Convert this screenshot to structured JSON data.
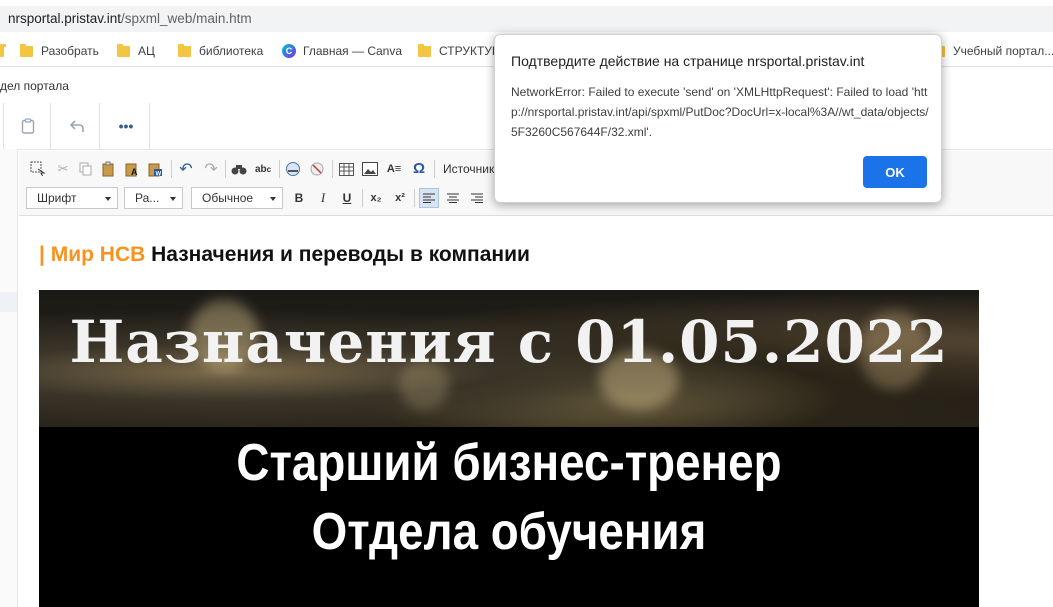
{
  "address_bar": {
    "host": "nrsportal.pristav.int",
    "path": "/spxml_web/main.htm"
  },
  "bookmarks": [
    {
      "label": "Разобрать",
      "icon": "folder-icon"
    },
    {
      "label": "АЦ",
      "icon": "folder-icon"
    },
    {
      "label": "библиотека",
      "icon": "folder-icon"
    },
    {
      "label": "Главная — Canva",
      "icon": "canva-icon"
    },
    {
      "label": "СТРУКТУРА",
      "icon": "folder-icon"
    },
    {
      "label": "Учебный портал...",
      "icon": "folder-icon"
    }
  ],
  "portal_strip": {
    "text": "дел портала"
  },
  "app_toolbar": {
    "icons": [
      "clipboard-icon",
      "undo-icon",
      "more-icon"
    ]
  },
  "editor_toolbar": {
    "source_label": "Источник",
    "font_combo": "Шрифт",
    "size_combo": "Ра...",
    "format_combo": "Обычное",
    "bold": "B",
    "italic": "I",
    "underline": "U",
    "subscript": "x₂",
    "superscript": "x²",
    "omega": "Ω"
  },
  "content": {
    "heading_accent": "| Мир НСВ",
    "heading_text": "Назначения и переводы в компании",
    "banner": {
      "title": "Назначения с 01.05.2022",
      "line1": "Старший бизнес-тренер",
      "line2": "Отдела обучения"
    }
  },
  "dialog": {
    "title": "Подтвердите действие на странице nrsportal.pristav.int",
    "message": "NetworkError: Failed to execute 'send' on 'XMLHttpRequest': Failed to load 'http://nrsportal.pristav.int/api/spxml/PutDoc?DocUrl=x-local%3A//wt_data/objects/5F3260C567644F/32.xml'.",
    "ok_label": "OK"
  },
  "colors": {
    "accent": "#f7931e",
    "ok_button": "#1a73e8"
  }
}
